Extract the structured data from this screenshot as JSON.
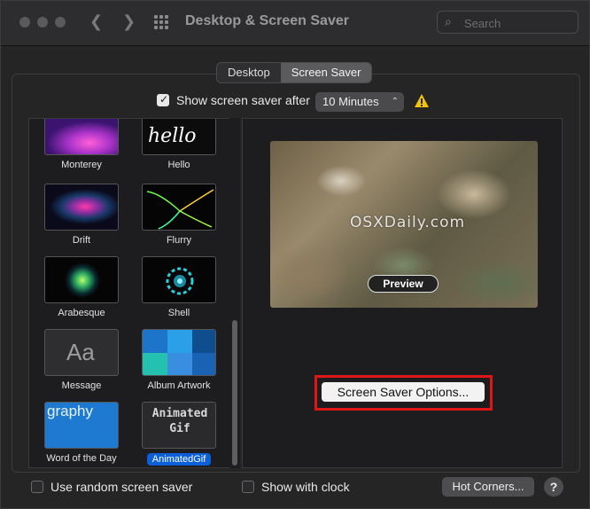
{
  "window": {
    "title": "Desktop & Screen Saver"
  },
  "search": {
    "placeholder": "Search"
  },
  "tabs": [
    {
      "label": "Desktop"
    },
    {
      "label": "Screen Saver"
    }
  ],
  "show_after": {
    "label": "Show screen saver after",
    "checked": true,
    "value": "10 Minutes"
  },
  "savers": [
    {
      "label": "Monterey"
    },
    {
      "label": "Hello",
      "thumb_text": "hello"
    },
    {
      "label": "Drift"
    },
    {
      "label": "Flurry"
    },
    {
      "label": "Arabesque"
    },
    {
      "label": "Shell"
    },
    {
      "label": "Message",
      "thumb_text": "Aa"
    },
    {
      "label": "Album Artwork"
    },
    {
      "label": "Word of the Day",
      "thumb_text": "graphy"
    },
    {
      "label": "AnimatedGif",
      "selected": true,
      "thumb_text": "Animated Gif"
    }
  ],
  "preview": {
    "watermark": "OSXDaily.com",
    "button": "Preview"
  },
  "options_button": "Screen Saver Options...",
  "bottom": {
    "random_label": "Use random screen saver",
    "clock_label": "Show with clock",
    "hot_corners": "Hot Corners...",
    "help": "?"
  },
  "colors": {
    "accent": "#0b5fd9",
    "highlight_border": "#e01515",
    "warning": "#f5c400"
  }
}
